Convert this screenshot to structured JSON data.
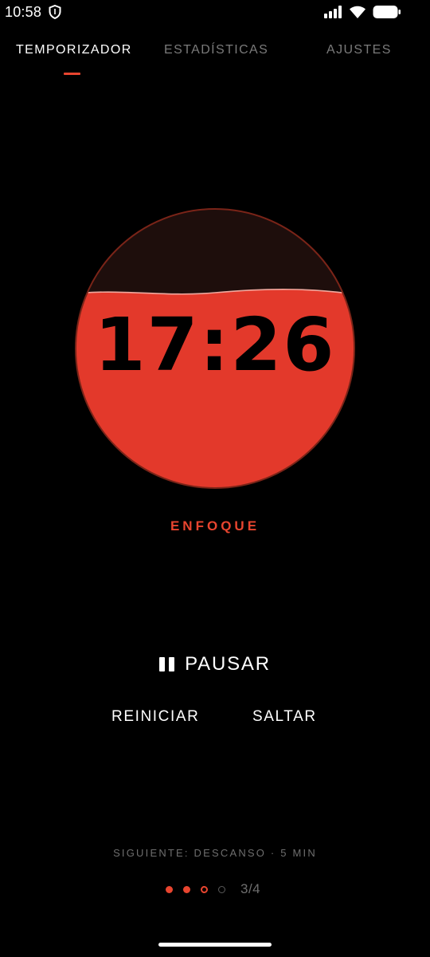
{
  "status_bar": {
    "time": "10:58",
    "icons": [
      "shield-icon",
      "signal-icon",
      "wifi-icon",
      "battery-icon"
    ]
  },
  "tabs": [
    {
      "label": "TEMPORIZADOR",
      "active": true
    },
    {
      "label": "ESTADÍSTICAS",
      "active": false
    },
    {
      "label": "AJUSTES",
      "active": false
    }
  ],
  "timer": {
    "time": "17:26",
    "mode": "ENFOQUE",
    "fill_fraction": 0.7
  },
  "controls": {
    "pause_label": "PAUSAR",
    "reset_label": "REINICIAR",
    "skip_label": "SALTAR"
  },
  "next": {
    "text": "SIGUIENTE: DESCANSO · 5 MIN"
  },
  "session_progress": {
    "completed": 2,
    "current": 3,
    "total": 4,
    "label": "3/4"
  },
  "colors": {
    "accent": "#e8452f",
    "background": "#000000",
    "circle_empty": "#1e0e0c",
    "circle_border": "#7a2418",
    "muted_text": "#7a7a7a"
  }
}
